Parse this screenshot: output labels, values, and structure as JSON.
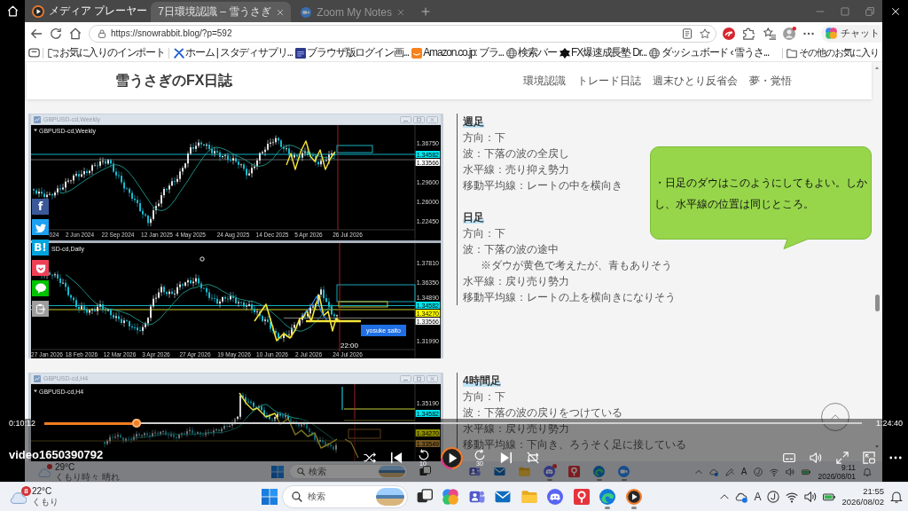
{
  "player": {
    "title": "メディア プレーヤー",
    "video_title": "video1650390792",
    "elapsed": "0:10:12",
    "duration": "1:24:40",
    "level": 0.113,
    "playing": false,
    "repeat": false,
    "replay_label": "10",
    "forward_label": "30"
  },
  "browser": {
    "tabs": [
      {
        "kind": "page",
        "title": "7日環境認識 – 雪うさぎ",
        "selected": true
      },
      {
        "kind": "camera",
        "title": "Zoom My Notes",
        "selected": false
      }
    ],
    "url": "https://snowrabbit.blog/?p=592",
    "chat_label": "チャット",
    "bookmarks": [
      {
        "kind": "import",
        "label": "お気に入りのインポート"
      },
      {
        "kind": "cross",
        "label": "ホーム | スタディサプリ..."
      },
      {
        "kind": "tile",
        "label": "ブラウザ版ログイン画..."
      },
      {
        "kind": "shop",
        "label": "Amazon.co.jp: ブラ..."
      },
      {
        "kind": "globe",
        "label": "検索バー"
      },
      {
        "kind": "burst",
        "label": "FX爆速成長塾 Dr..."
      },
      {
        "kind": "globe",
        "label": "ダッシュボード ‹ 雪うさ..."
      }
    ],
    "other_bookmarks": "その他のお気に入り"
  },
  "blog": {
    "title": "雪うさぎのFX日誌",
    "nav": [
      "環境認識",
      "トレード日誌",
      "週末ひとり反省会",
      "夢・覚悟"
    ],
    "share_buttons": [
      {
        "kind": "letter",
        "label": "f",
        "color": "#3b5998"
      },
      {
        "kind": "bird",
        "color": "#1da1f2"
      },
      {
        "kind": "letter",
        "label": "B!",
        "color": "#00a4de"
      },
      {
        "kind": "shield",
        "color": "#ef4056"
      },
      {
        "kind": "bubble",
        "color": "#00c300"
      },
      {
        "kind": "clip",
        "color": "#9e9e9e"
      }
    ],
    "sections": [
      {
        "image": {
          "window_title": "GBPUSD-cd,Weekly",
          "panes": [
            {
              "kind": "weekly",
              "symbol": "GBPUSD-cd,Weekly",
              "prices": [
                {
                  "text": "1.36750"
                },
                {
                  "text": "1.34582",
                  "color": "#00e5ee"
                },
                {
                  "text": "1.33566",
                  "color": "#ffffff"
                },
                {
                  "text": "1.29600"
                },
                {
                  "text": "1.26000"
                },
                {
                  "text": "1.22450"
                }
              ],
              "dates": [
                "024",
                "2 Jun 2024",
                "22 Sep 2024",
                "12 Jan 2025",
                "4 May 2025",
                "24 Aug 2025",
                "14 Dec 2025",
                "5 Apr 2026",
                "26 Jul 2026"
              ]
            },
            {
              "kind": "daily",
              "symbol": "SD-cd,Daily",
              "prices": [
                {
                  "text": "1.37810"
                },
                {
                  "text": "1.36350"
                },
                {
                  "text": "1.34890"
                },
                {
                  "text": "1.34582",
                  "color": "#00e5ee"
                },
                {
                  "text": "1.34270",
                  "color": "#ffff00"
                },
                {
                  "text": "1.33566",
                  "color": "#ffffff"
                },
                {
                  "text": "1.31990"
                }
              ],
              "dates": [
                "27 Jan 2026",
                "18 Feb 2026",
                "12 Mar 2026",
                "3 Apr 2026",
                "27 Apr 2026",
                "19 May 2026",
                "10 Jun 2026",
                "2 Jul 2026",
                "24 Jul 2026"
              ],
              "time": "22:00",
              "tag": "yosuke saito"
            }
          ]
        },
        "notes": [
          {
            "heading": "週足",
            "lines": [
              {
                "kind": "plain",
                "text": "方向：下"
              },
              {
                "kind": "plain",
                "text": "波：下落の波の全戻し"
              },
              {
                "kind": "plain",
                "text": "水平線：売り抑え勢力"
              },
              {
                "kind": "plain",
                "text": "移動平均線：レートの中を横向き"
              }
            ]
          },
          {
            "heading": "日足",
            "lines": [
              {
                "kind": "plain",
                "text": "方向：下"
              },
              {
                "kind": "plain",
                "text": "波：下落の波の途中"
              },
              {
                "kind": "note",
                "text": "※ダウが黄色で考えたが、青もありそう"
              },
              {
                "kind": "plain",
                "text": "水平線：戻り売り勢力"
              },
              {
                "kind": "plain",
                "text": "移動平均線：レートの上を横向きになりそう"
              }
            ]
          }
        ],
        "callout": "・日足のダウはこのようにしてもよい。しかし、水平線の位置は同じところ。"
      },
      {
        "image": {
          "window_title": "GBPUSD-cd,H4",
          "panes": [
            {
              "kind": "h4",
              "symbol": "GBPUSD-cd,H4",
              "prices": [
                {
                  "text": "1.35190"
                },
                {
                  "text": "1.34582",
                  "color": "#00e5ee"
                },
                {
                  "text": "1.34270",
                  "color": "#8c8c00"
                },
                {
                  "text": "1.33549",
                  "color": "#775823"
                }
              ]
            }
          ]
        },
        "notes": [
          {
            "heading": "4時間足",
            "lines": [
              {
                "kind": "plain",
                "text": "方向：下"
              },
              {
                "kind": "plain",
                "text": "波：下落の波の戻りをつけている"
              },
              {
                "kind": "plain",
                "text": "水平線：戻り売り勢力"
              },
              {
                "kind": "plain",
                "text": "移動平均線：下向き、ろうそく足に接している"
              }
            ]
          }
        ]
      }
    ]
  },
  "video_taskbar": {
    "weather": {
      "alert": true,
      "temp": "29°C",
      "text": "くもり時々 晴れ"
    },
    "search": {
      "placeholder": "検索"
    },
    "apps": [
      {
        "kind": "taskview",
        "running": false,
        "alert": false
      },
      {
        "kind": "people",
        "running": false,
        "alert": false
      },
      {
        "kind": "mail",
        "running": false,
        "alert": false
      },
      {
        "kind": "folder",
        "running": false,
        "alert": false
      },
      {
        "kind": "controller",
        "running": true,
        "alert": true
      },
      {
        "kind": "pin",
        "running": false,
        "alert": false
      },
      {
        "kind": "swirl",
        "running": true,
        "alert": false
      },
      {
        "kind": "camera",
        "running": true,
        "alert": false
      }
    ],
    "tray": [
      {
        "kind": "cloud"
      },
      {
        "kind": "pen"
      }
    ],
    "ime": "A",
    "clock": {
      "time": "9:11",
      "date": "2026/08/01"
    }
  },
  "taskbar": {
    "weather": {
      "badge": "8",
      "temp": "22°C",
      "text": "くもり"
    },
    "search": {
      "placeholder": "検索"
    },
    "apps": [
      {
        "kind": "taskview",
        "running": false
      },
      {
        "kind": "blob",
        "running": false
      },
      {
        "kind": "people",
        "running": false
      },
      {
        "kind": "mail",
        "running": false
      },
      {
        "kind": "folder",
        "running": false
      },
      {
        "kind": "controller",
        "running": false
      },
      {
        "kind": "pin",
        "running": false
      },
      {
        "kind": "swirl",
        "running": true
      },
      {
        "kind": "player",
        "running": true
      }
    ],
    "tray": [
      {
        "kind": "cloud"
      }
    ],
    "ime": "A",
    "clock": {
      "time": "21:55",
      "date": "2026/08/02"
    }
  }
}
